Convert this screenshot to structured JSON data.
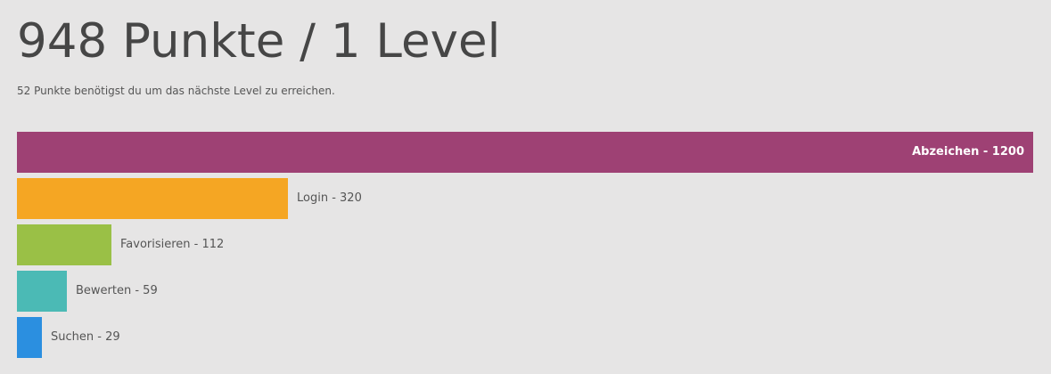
{
  "header": {
    "title": "948 Punkte / 1 Level",
    "subtitle": "52 Punkte benötigst du um das nächste Level zu erreichen."
  },
  "chart_data": {
    "type": "bar",
    "orientation": "horizontal",
    "categories": [
      "Abzeichen",
      "Login",
      "Favorisieren",
      "Bewerten",
      "Suchen"
    ],
    "values": [
      1200,
      320,
      112,
      59,
      29
    ],
    "labels": [
      "Abzeichen - 1200",
      "Login - 320",
      "Favorisieren - 112",
      "Bewerten - 59",
      "Suchen - 29"
    ],
    "colors": [
      "#9e4174",
      "#f5a623",
      "#9ac046",
      "#4bbab5",
      "#2b8fe0"
    ],
    "xlim": [
      0,
      1200
    ],
    "grid": false
  }
}
